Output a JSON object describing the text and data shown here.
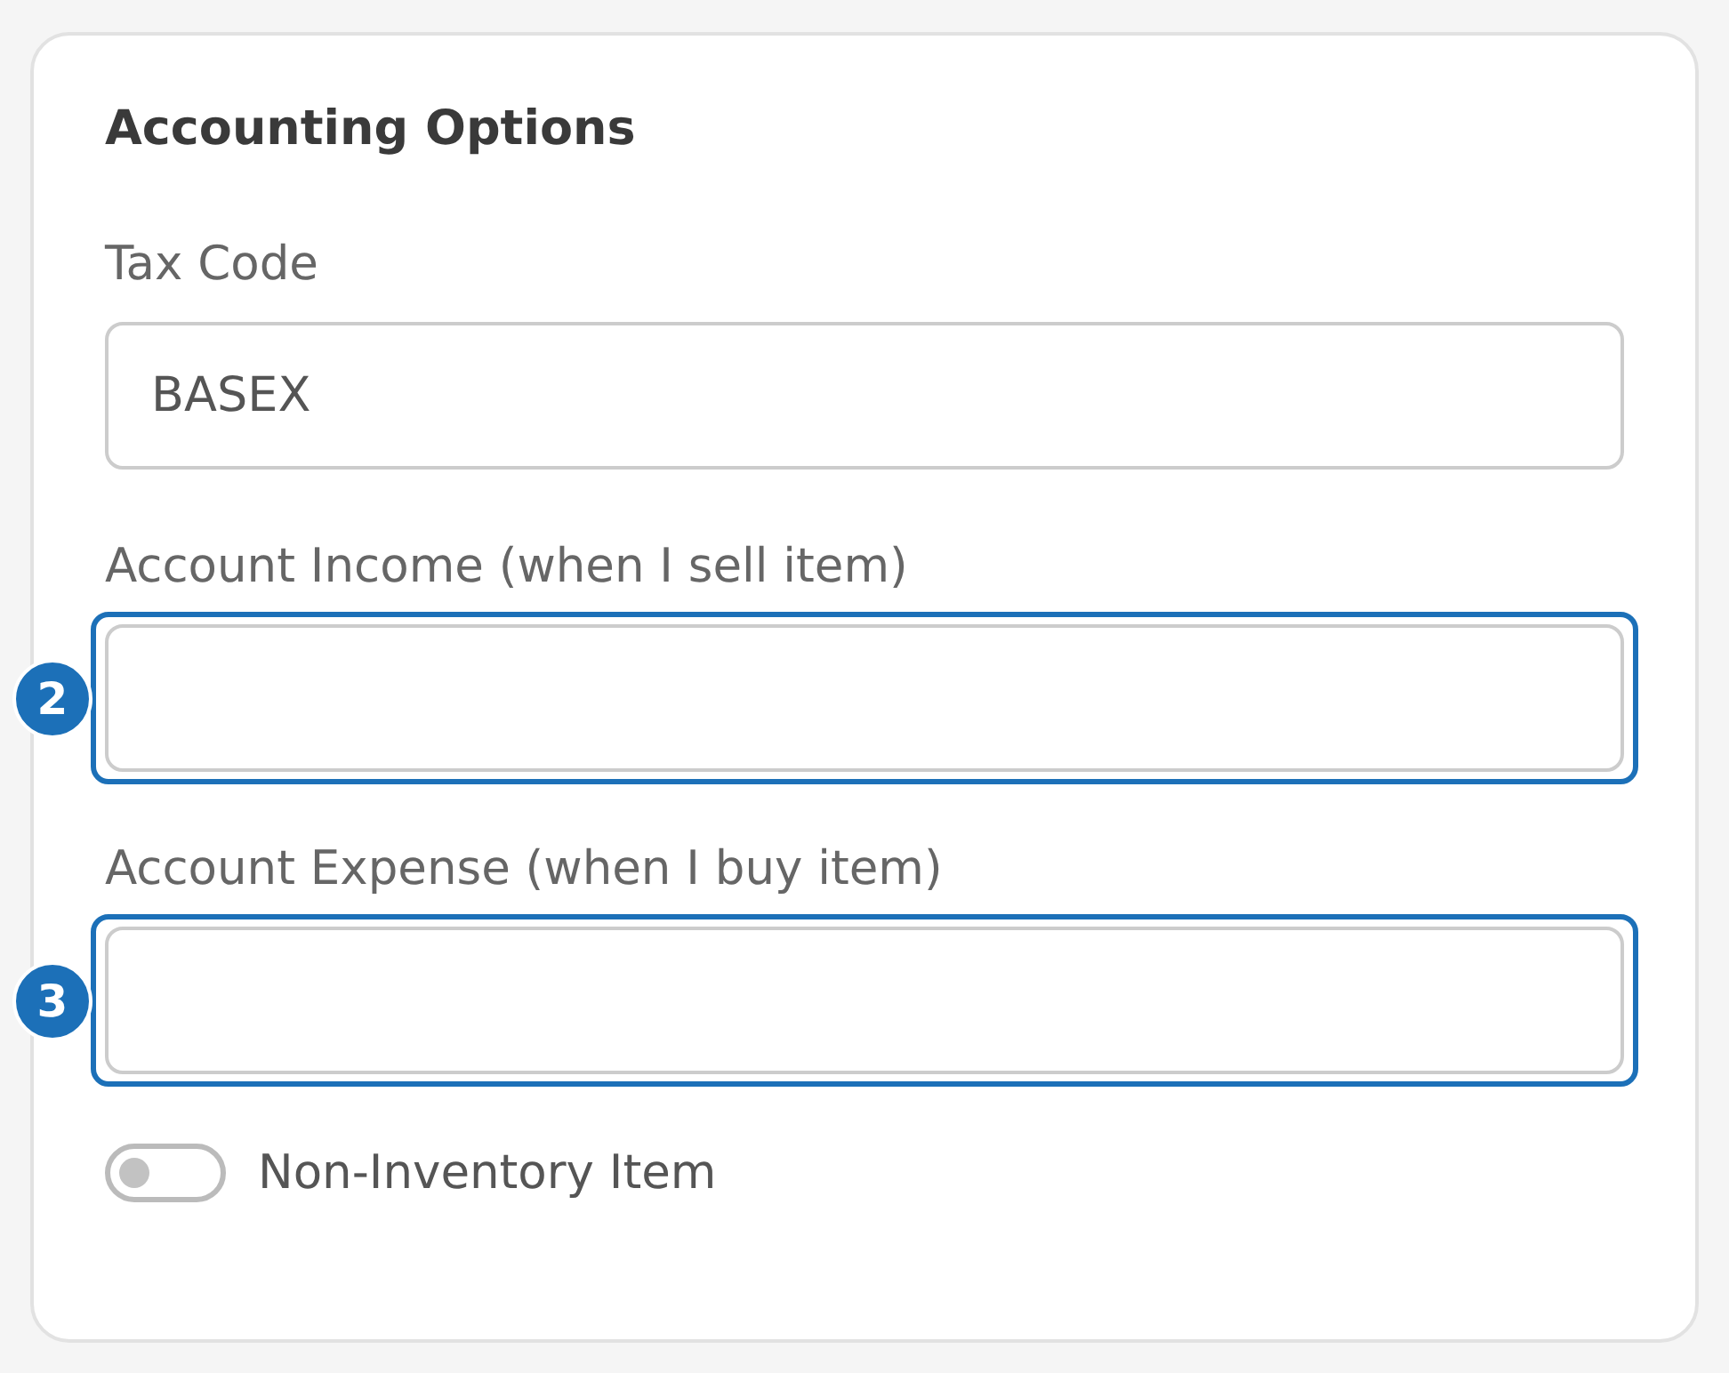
{
  "card": {
    "title": "Accounting Options"
  },
  "fields": [
    {
      "label": "Tax Code",
      "value": "BASEX",
      "highlighted": false
    },
    {
      "label": "Account Income (when I sell item)",
      "highlighted": true,
      "marker": "2"
    },
    {
      "label": "Account Expense (when I buy item)",
      "highlighted": true,
      "marker": "3"
    }
  ],
  "toggle": {
    "label": "Non-Inventory Item",
    "on": false
  }
}
